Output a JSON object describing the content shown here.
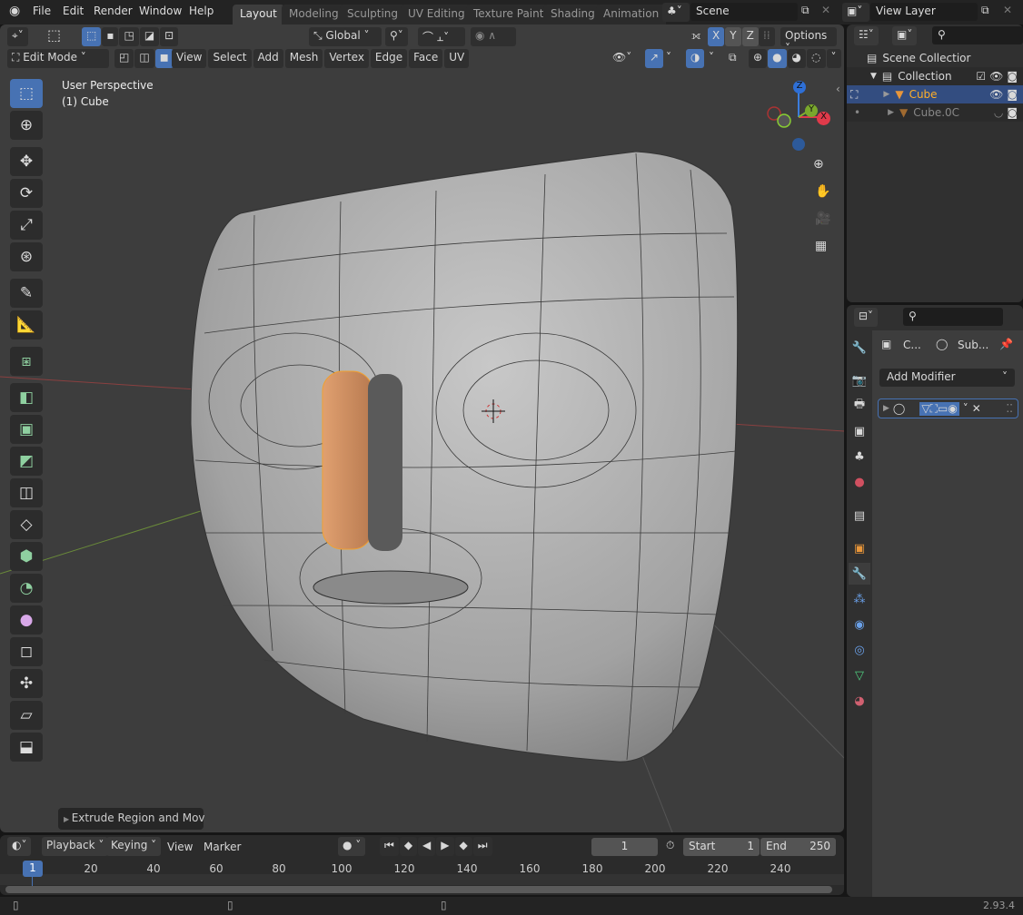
{
  "menubar": {
    "items": [
      "File",
      "Edit",
      "Render",
      "Window",
      "Help"
    ]
  },
  "workspaces": [
    "Layout",
    "Modeling",
    "Sculpting",
    "UV Editing",
    "Texture Paint",
    "Shading",
    "Animation"
  ],
  "active_workspace": "Layout",
  "scene": {
    "name": "Scene"
  },
  "view_layer": {
    "name": "View Layer"
  },
  "viewport": {
    "mode": "Edit Mode",
    "menus": [
      "View",
      "Select",
      "Add",
      "Mesh",
      "Vertex",
      "Edge",
      "Face",
      "UV"
    ],
    "transform_orientation": "Global",
    "axes": [
      "X",
      "Y",
      "Z"
    ],
    "options_label": "Options",
    "overlay_title": "User Perspective",
    "overlay_object": "(1) Cube",
    "gizmo_labels": {
      "z": "Z",
      "y": "Y",
      "x": "X"
    },
    "last_operator": "Extrude Region and Mov"
  },
  "outliner": {
    "items": [
      {
        "label": "Scene Collectior"
      },
      {
        "label": "Collection"
      },
      {
        "label": "Cube",
        "selected": true
      },
      {
        "label": "Cube.0C"
      }
    ]
  },
  "properties": {
    "breadcrumb": [
      "C...",
      "Sub..."
    ],
    "add_modifier": "Add Modifier"
  },
  "timeline": {
    "menus": [
      "Playback",
      "Keying",
      "View",
      "Marker"
    ],
    "current_frame": "1",
    "start_label": "Start",
    "start": "1",
    "end_label": "End",
    "end": "250",
    "ticks": [
      "20",
      "40",
      "60",
      "80",
      "100",
      "120",
      "140",
      "160",
      "180",
      "200",
      "220",
      "240"
    ],
    "playhead": "1"
  },
  "statusbar": {
    "version": "2.93.4"
  },
  "colors": {
    "accent": "#4772b3",
    "selected_text": "#ffaf29",
    "mesh_selected": "#e8a060"
  }
}
